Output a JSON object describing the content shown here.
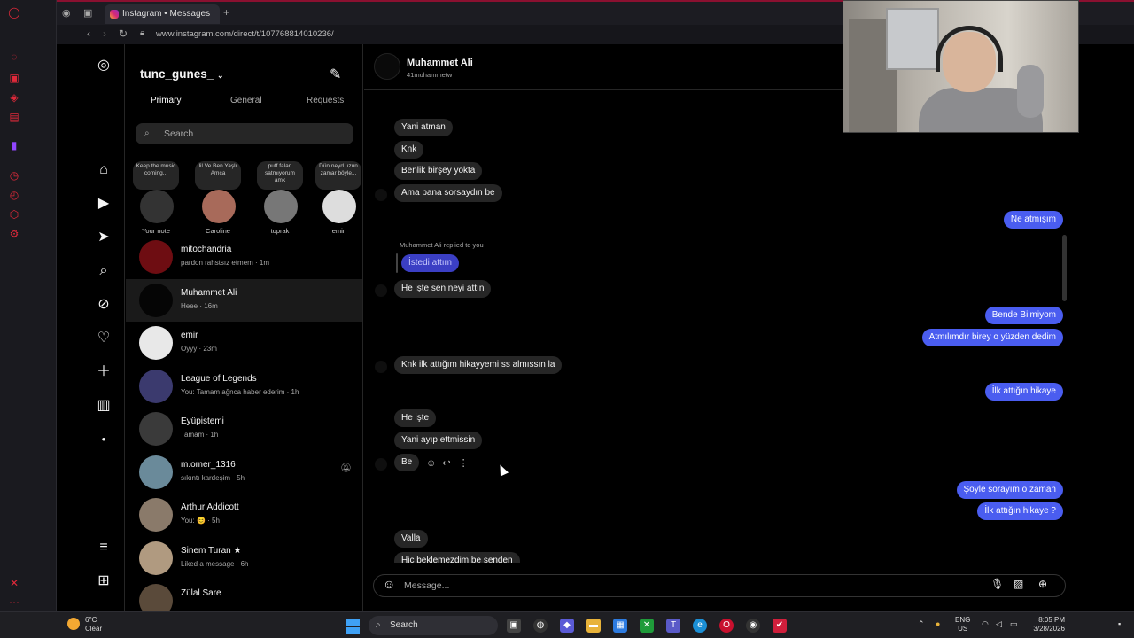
{
  "browser": {
    "tab_title": "Instagram • Messages",
    "url": "www.instagram.com/direct/t/107768814010236/"
  },
  "dm_list": {
    "username": "tunc_gunes_",
    "tabs": [
      "Primary",
      "General",
      "Requests"
    ],
    "search_placeholder": "Search",
    "notes": [
      {
        "bubble": "Keep the music coming...",
        "label": "Your note",
        "color": "#333"
      },
      {
        "bubble": "lil Ve Ben Yaşlı Amca",
        "label": "Caroline",
        "color": "#a86a5a"
      },
      {
        "bubble": "puff falan satmıyorum amk",
        "label": "toprak",
        "color": "#777"
      },
      {
        "bubble": "Dün neyd uzun zamar böyle...",
        "label": "emir",
        "color": "#ddd"
      }
    ],
    "conversations": [
      {
        "name": "mitochandria",
        "preview": "pardon rahstsız etmem · 1m",
        "color": "#6e0d12"
      },
      {
        "name": "Muhammet Ali",
        "preview": "Heee · 16m",
        "color": "#050505"
      },
      {
        "name": "emir",
        "preview": "Oyyy · 23m",
        "color": "#e8e8e8"
      },
      {
        "name": "League of Legends",
        "preview": "You: Tamam ağnca haber ederim · 1h",
        "color": "#3b3a6e"
      },
      {
        "name": "Eyüpistemi",
        "preview": "Tamam · 1h",
        "color": "#3a3a3a"
      },
      {
        "name": "m.omer_1316",
        "preview": "sıkıntı kardeşim · 5h",
        "color": "#6a8a9a"
      },
      {
        "name": "Arthur Addicott",
        "preview": "You: 😊 · 5h",
        "color": "#8a7a6a"
      },
      {
        "name": "Sinem Turan ★",
        "preview": "Liked a message · 6h",
        "color": "#b09a80"
      },
      {
        "name": "Zülal Sare",
        "preview": "",
        "color": "#5a4a3a"
      }
    ]
  },
  "chat": {
    "name": "Muhammet Ali",
    "handle": "41muhammetw",
    "reply_note": "Muhammet Ali replied to you",
    "messages": {
      "m1": "Yani atman",
      "m2": "Knk",
      "m3": "Benlik birşey yokta",
      "m4": "Ama bana sorsaydın be",
      "o1": "Ne atmışım",
      "r1": "İstedi attım",
      "m5": "He işte sen neyi attın",
      "o2": "Bende Bilmiyom",
      "o3": "Atmılımdır birey o yüzden dedim",
      "m6": "Knk ilk attığım hikayyemi ss almıssın la",
      "o4": "İlk attığın hikaye",
      "m7": "He işte",
      "m8": "Yani ayıp ettmissin",
      "m9": "Be",
      "o5": "Şöyle sorayım o zaman",
      "o6": "İlk attığın hikaye ?",
      "m10": "Valla",
      "m11": "Hiç beklemezdim be senden"
    },
    "composer_placeholder": "Message..."
  },
  "taskbar": {
    "temp": "6°C",
    "weather": "Clear",
    "search": "Search",
    "lang1": "ENG",
    "lang2": "US",
    "time": "8:05 PM",
    "date": "3/28/2026"
  },
  "icons": [
    "instagram-icon",
    "home-icon",
    "reels-icon",
    "messages-icon",
    "search-icon",
    "explore-icon",
    "heart-icon",
    "create-icon",
    "dashboard-icon",
    "menu-icon",
    "apps-icon"
  ],
  "colors": {
    "outgoing": "#4a5df0",
    "incoming": "#262626",
    "accent_red": "#e0293a"
  }
}
